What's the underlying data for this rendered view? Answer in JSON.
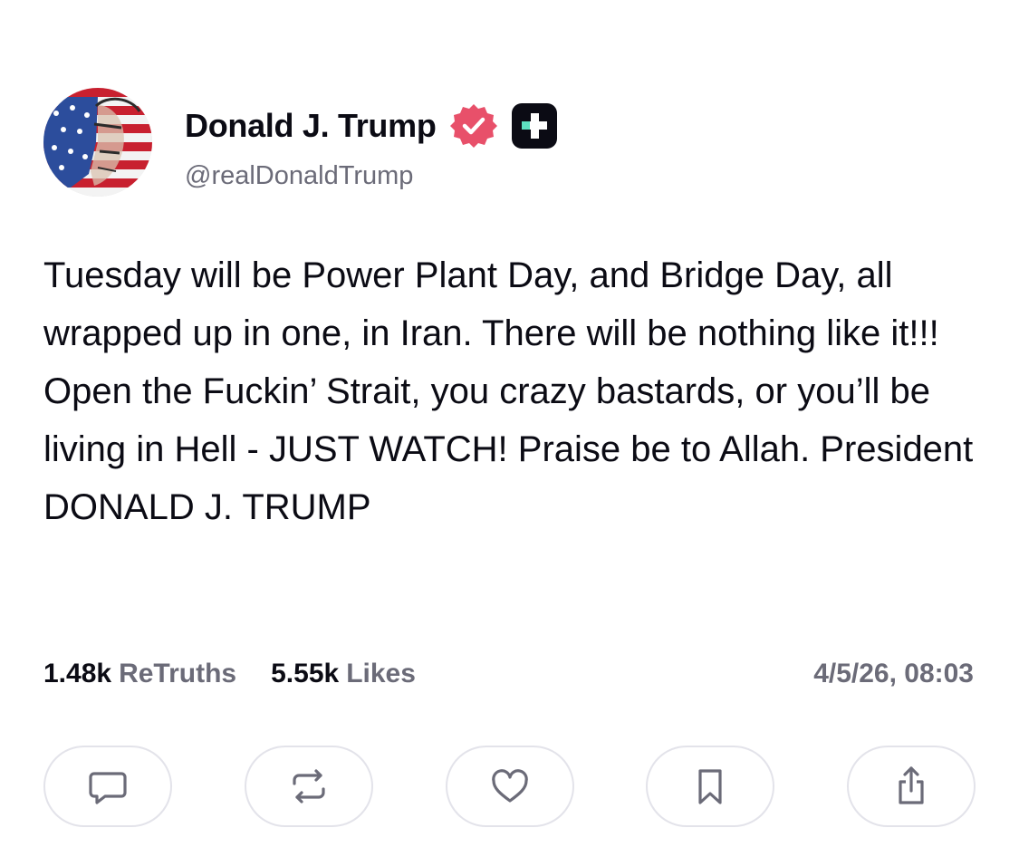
{
  "author": {
    "display_name": "Donald J. Trump",
    "handle": "@realDonaldTrump",
    "verified_badge_icon": "verified-badge-icon",
    "plus_badge_icon": "plus-badge-icon",
    "verified_color": "#e8506a"
  },
  "post": {
    "text": "Tuesday will be Power Plant Day, and Bridge Day, all wrapped up in one, in Iran. There will be nothing like it!!! Open the Fuckin’ Strait, you crazy bastards, or you’ll be living in Hell - JUST WATCH! Praise be to Allah. President DONALD J. TRUMP"
  },
  "stats": {
    "retruths_count": "1.48k",
    "retruths_label": "ReTruths",
    "likes_count": "5.55k",
    "likes_label": "Likes",
    "timestamp": "4/5/26, 08:03"
  },
  "actions": [
    {
      "icon": "reply-icon"
    },
    {
      "icon": "retruth-icon"
    },
    {
      "icon": "like-icon"
    },
    {
      "icon": "bookmark-icon"
    },
    {
      "icon": "share-icon"
    }
  ],
  "colors": {
    "text_primary": "#0b0b14",
    "text_secondary": "#6b6b78",
    "button_border": "#e3e3ea",
    "icon_color": "#6b6b78"
  }
}
